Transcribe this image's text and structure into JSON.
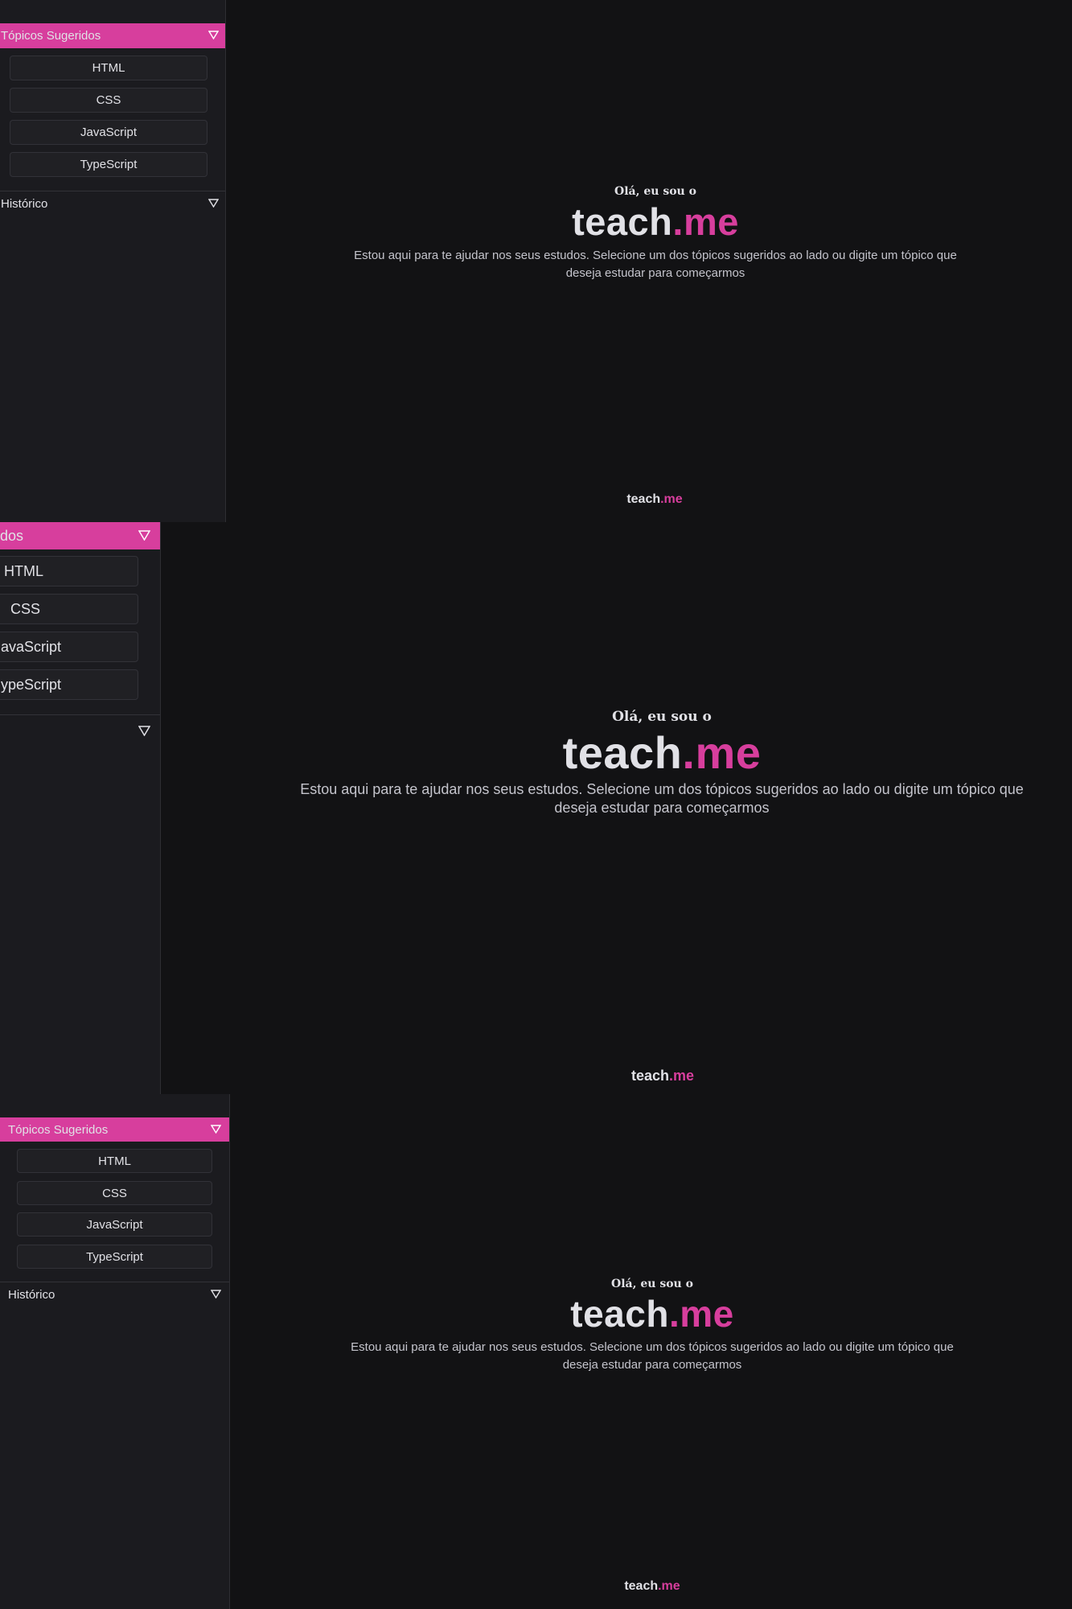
{
  "sidebar": {
    "suggested_title": "Tópicos Sugeridos",
    "suggested_title_cropped": "dos",
    "history_title": "Histórico",
    "topics": [
      "HTML",
      "CSS",
      "JavaScript",
      "TypeScript"
    ],
    "topics_cropped": [
      "HTML",
      "CSS",
      "avaScript",
      "ypeScript"
    ],
    "collapse_icon": "triangle-down-outline-icon"
  },
  "main": {
    "greeting": "Olá, eu sou o",
    "brand_main": "teach",
    "brand_accent": ".me",
    "description": "Estou aqui para te ajudar nos seus estudos. Selecione um dos tópicos sugeridos ao lado ou digite um tópico que deseja estudar para começarmos"
  },
  "footer": {
    "brand_main": "teach",
    "brand_accent": ".me"
  },
  "colors": {
    "background": "#121214",
    "sidebar": "#1b1b1f",
    "accent": "#d73e9d",
    "text": "#e1e1e6"
  }
}
